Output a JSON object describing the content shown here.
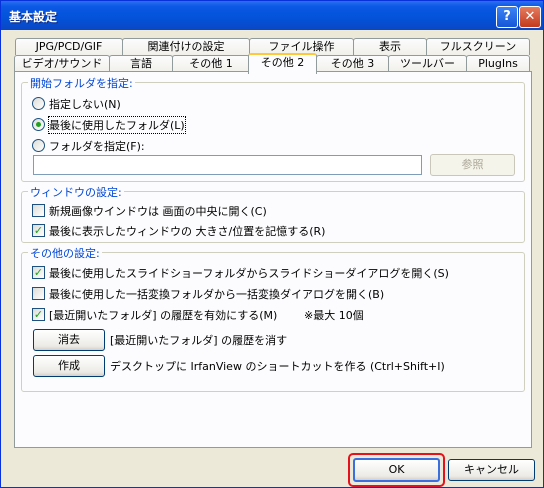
{
  "window": {
    "title": "基本設定",
    "help_button": "?",
    "close_button": "✕"
  },
  "tabs": {
    "row_back": [
      "JPG/PCD/GIF",
      "関連付けの設定",
      "ファイル操作",
      "表示",
      "フルスクリーン"
    ],
    "row_front": [
      "ビデオ/サウンド",
      "言語",
      "その他 1",
      "その他 2",
      "その他 3",
      "ツールバー",
      "PlugIns"
    ],
    "active": "その他 2"
  },
  "start_folder": {
    "group_label": "開始フォルダを指定:",
    "options": [
      "指定しない(N)",
      "最後に使用したフォルダ(L)",
      "フォルダを指定(F):"
    ],
    "selected": "最後に使用したフォルダ(L)",
    "folder_value": "",
    "browse_label": "参照"
  },
  "window_settings": {
    "group_label": "ウィンドウの設定:",
    "center_new": {
      "label": "新規画像ウインドウは 画面の中央に開く(C)",
      "checked": false
    },
    "remember_size": {
      "label": "最後に表示したウィンドウの 大きさ/位置を記憶する(R)",
      "checked": true
    }
  },
  "other_settings": {
    "group_label": "その他の設定:",
    "slideshow": {
      "label": "最後に使用したスライドショーフォルダからスライドショーダイアログを開く(S)",
      "checked": true
    },
    "batch": {
      "label": "最後に使用した一括変換フォルダから一括変換ダイアログを開く(B)",
      "checked": false
    },
    "recent": {
      "label": "[最近開いたフォルダ] の履歴を有効にする(M)",
      "checked": true,
      "note": "※最大 10個"
    },
    "clear_button": "消去",
    "clear_desc": "[最近開いたフォルダ] の履歴を消す",
    "create_button": "作成",
    "create_desc": "デスクトップに IrfanView のショートカットを作る (Ctrl+Shift+I)"
  },
  "footer": {
    "ok": "OK",
    "cancel": "キャンセル"
  },
  "colors": {
    "titlebar": "#0352d8",
    "group_label": "#0046d5",
    "highlight": "#e4131b",
    "check": "#21a121"
  }
}
